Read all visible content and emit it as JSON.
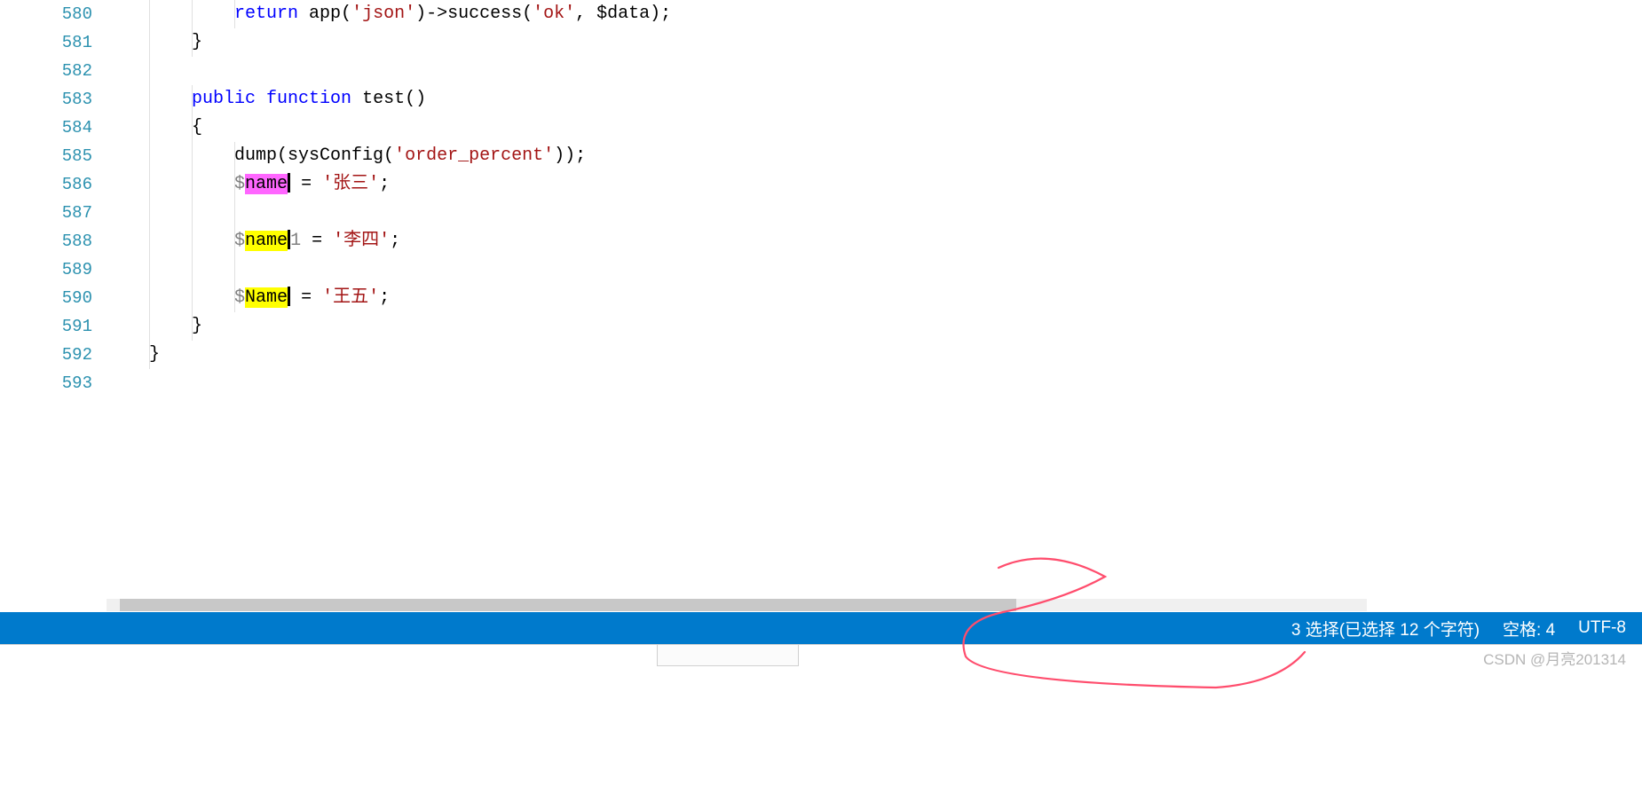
{
  "gutter": {
    "start": 580,
    "end": 593
  },
  "code": {
    "lines": [
      {
        "n": 580,
        "indent": 3,
        "segments": [
          {
            "t": "            ",
            "c": "default"
          },
          {
            "t": "return",
            "c": "kw"
          },
          {
            "t": " app(",
            "c": "default"
          },
          {
            "t": "'json'",
            "c": "str"
          },
          {
            "t": ")->success(",
            "c": "default"
          },
          {
            "t": "'ok'",
            "c": "str"
          },
          {
            "t": ", $data);",
            "c": "default"
          }
        ]
      },
      {
        "n": 581,
        "indent": 2,
        "segments": [
          {
            "t": "        }",
            "c": "default"
          }
        ]
      },
      {
        "n": 582,
        "indent": 1,
        "segments": []
      },
      {
        "n": 583,
        "indent": 2,
        "segments": [
          {
            "t": "        ",
            "c": "default"
          },
          {
            "t": "public",
            "c": "kw"
          },
          {
            "t": " ",
            "c": "default"
          },
          {
            "t": "function",
            "c": "kw"
          },
          {
            "t": " test()",
            "c": "default"
          }
        ]
      },
      {
        "n": 584,
        "indent": 2,
        "segments": [
          {
            "t": "        {",
            "c": "default"
          }
        ]
      },
      {
        "n": 585,
        "indent": 3,
        "segments": [
          {
            "t": "            dump(sysConfig(",
            "c": "default"
          },
          {
            "t": "'order_percent'",
            "c": "str"
          },
          {
            "t": "));",
            "c": "default"
          }
        ]
      },
      {
        "n": 586,
        "indent": 3,
        "segments": [
          {
            "t": "            ",
            "c": "default"
          },
          {
            "t": "$",
            "c": "var"
          },
          {
            "t": "name",
            "c": "hl-primary"
          },
          {
            "t": "",
            "c": "cursor"
          },
          {
            "t": " = ",
            "c": "default"
          },
          {
            "t": "'张三'",
            "c": "str"
          },
          {
            "t": ";",
            "c": "default"
          }
        ]
      },
      {
        "n": 587,
        "indent": 3,
        "segments": []
      },
      {
        "n": 588,
        "indent": 3,
        "segments": [
          {
            "t": "            ",
            "c": "default"
          },
          {
            "t": "$",
            "c": "var"
          },
          {
            "t": "name",
            "c": "hl-match"
          },
          {
            "t": "",
            "c": "cursor"
          },
          {
            "t": "1",
            "c": "var"
          },
          {
            "t": " = ",
            "c": "default"
          },
          {
            "t": "'李四'",
            "c": "str"
          },
          {
            "t": ";",
            "c": "default"
          }
        ]
      },
      {
        "n": 589,
        "indent": 3,
        "segments": []
      },
      {
        "n": 590,
        "indent": 3,
        "segments": [
          {
            "t": "            ",
            "c": "default"
          },
          {
            "t": "$",
            "c": "var"
          },
          {
            "t": "Name",
            "c": "hl-match"
          },
          {
            "t": "",
            "c": "cursor"
          },
          {
            "t": " = ",
            "c": "default"
          },
          {
            "t": "'王五'",
            "c": "str"
          },
          {
            "t": ";",
            "c": "default"
          }
        ]
      },
      {
        "n": 591,
        "indent": 2,
        "segments": [
          {
            "t": "        }",
            "c": "default"
          }
        ]
      },
      {
        "n": 592,
        "indent": 1,
        "segments": [
          {
            "t": "    }",
            "c": "default"
          }
        ]
      },
      {
        "n": 593,
        "indent": 0,
        "segments": []
      }
    ]
  },
  "status": {
    "selection": "3 选择(已选择 12 个字符)",
    "indent": "空格: 4",
    "encoding": "UTF-8"
  },
  "watermark": "CSDN @月亮201314"
}
